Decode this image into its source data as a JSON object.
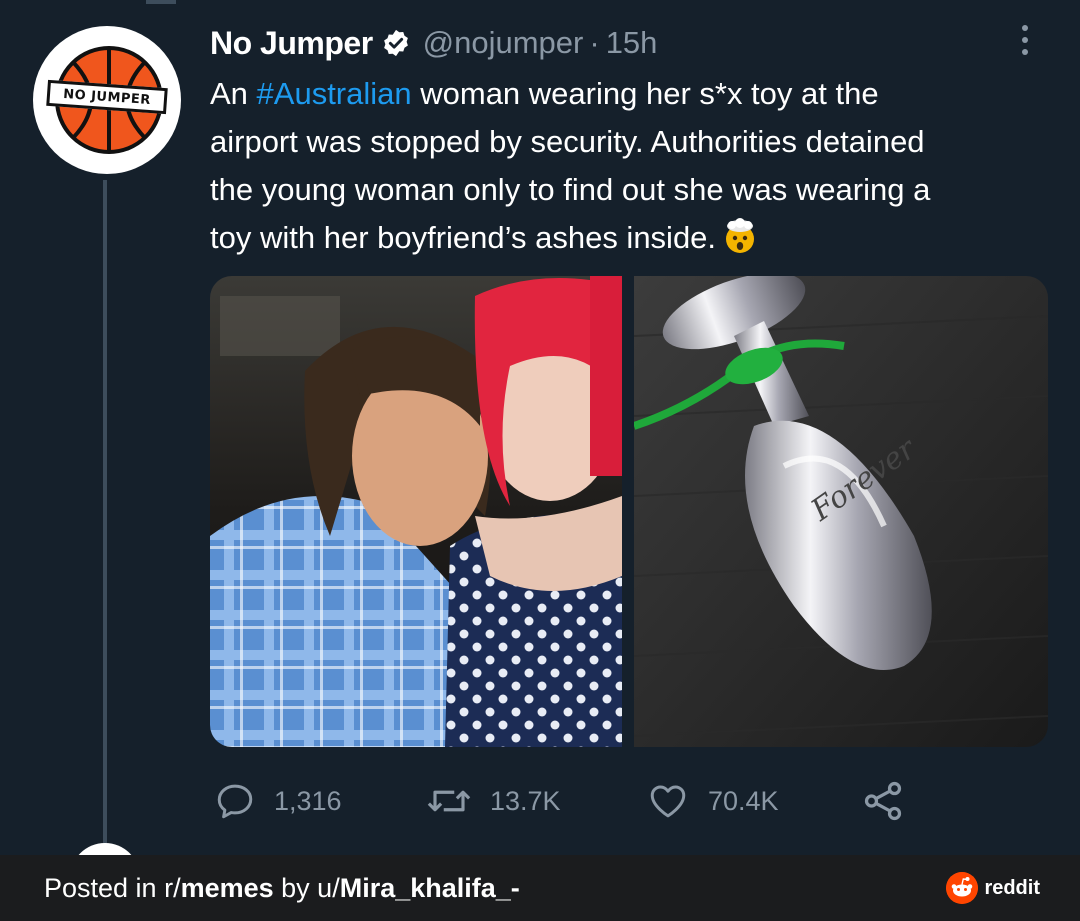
{
  "tweet": {
    "author": {
      "display_name": "No Jumper",
      "handle": "@nojumper",
      "separator": "·",
      "time": "15h",
      "avatar_label": "NO JUMPER",
      "verified_icon": "verified-badge-icon"
    },
    "text": {
      "line1_before": "An ",
      "hashtag": "#Australian",
      "line1_after": " woman wearing her s*x toy at the",
      "line2": "airport was stopped by security. Authorities detained",
      "line3": "the young woman only to find out she was wearing a",
      "line4": "toy with her boyfriend’s ashes inside.",
      "emoji": "exploding-head-emoji"
    },
    "media": [
      {
        "subject": "couple-photo"
      },
      {
        "subject": "object-photo",
        "engraving": "Forever"
      }
    ],
    "actions": {
      "reply_count": "1,316",
      "retweet_count": "13.7K",
      "like_count": "70.4K"
    }
  },
  "footer": {
    "prefix": "Posted in r/",
    "subreddit": "memes",
    "by": " by u/",
    "user": "Mira_khalifa_-",
    "brand": "reddit"
  },
  "colors": {
    "background": "#15202b",
    "text_secondary": "#8b98a5",
    "link": "#1d9bf0",
    "footer_bg": "#1b1c1e",
    "reddit_orange": "#ff4500"
  }
}
